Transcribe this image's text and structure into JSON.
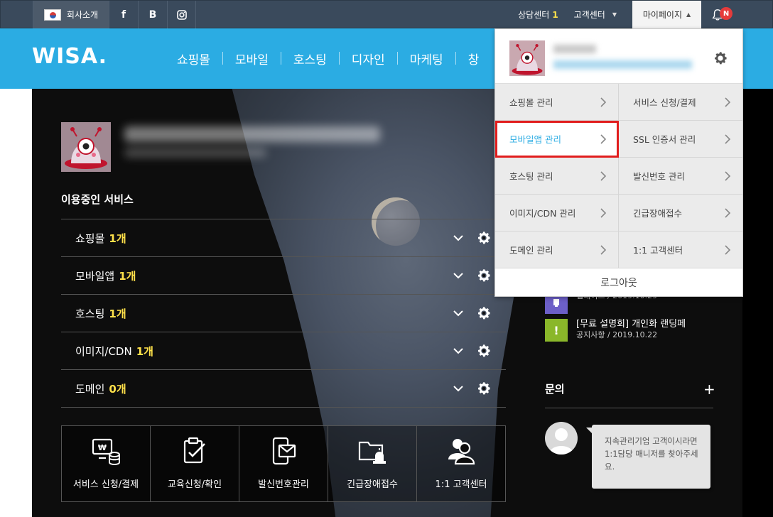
{
  "topbar": {
    "company_label": "회사소개",
    "sns": [
      "f",
      "B"
    ],
    "consult_label": "상담센터",
    "consult_count": "1",
    "support_label": "고객센터",
    "mypage_label": "마이페이지",
    "notification_badge": "N"
  },
  "nav": {
    "logo": "WISA.",
    "menu": [
      "쇼핑몰",
      "모바일",
      "호스팅",
      "디자인",
      "마케팅",
      "창"
    ]
  },
  "services": {
    "title": "이용중인 서비스",
    "rows": [
      {
        "label": "쇼핑몰",
        "count": "1개"
      },
      {
        "label": "모바일앱",
        "count": "1개"
      },
      {
        "label": "호스팅",
        "count": "1개"
      },
      {
        "label": "이미지/CDN",
        "count": "1개"
      },
      {
        "label": "도메인",
        "count": "0개"
      }
    ]
  },
  "quick_menu": [
    {
      "label": "서비스 신청/결제",
      "icon": "billing-icon"
    },
    {
      "label": "교육신청/확인",
      "icon": "clipboard-check-icon"
    },
    {
      "label": "발신번호관리",
      "icon": "phone-mail-icon"
    },
    {
      "label": "긴급장애접수",
      "icon": "emergency-folder-icon"
    },
    {
      "label": "1:1 고객센터",
      "icon": "users-icon"
    }
  ],
  "notices": [
    {
      "title": "",
      "meta": "업데이트 / 2019.10.29",
      "color": "#6c5fc7",
      "icon": "update-icon"
    },
    {
      "title": "[무료 설명회] 개인화 랜딩페",
      "meta": "공지사항 / 2019.10.22",
      "color": "#8ab72a",
      "icon": "exclamation-icon"
    }
  ],
  "inquiry": {
    "title": "문의",
    "message": "지속관리기업 고객이시라면 1:1담당 매니저를 찾아주세요."
  },
  "dropdown": {
    "items": [
      {
        "label": "쇼핑몰 관리"
      },
      {
        "label": "서비스 신청/결제"
      },
      {
        "label": "모바일앱 관리",
        "active": true
      },
      {
        "label": "SSL 인증서 관리"
      },
      {
        "label": "호스팅 관리"
      },
      {
        "label": "발신번호 관리"
      },
      {
        "label": "이미지/CDN 관리"
      },
      {
        "label": "긴급장애접수"
      },
      {
        "label": "도메인 관리"
      },
      {
        "label": "1:1 고객센터"
      }
    ],
    "logout_label": "로그아웃"
  },
  "colors": {
    "nav_blue": "#2bace3",
    "topbar": "#3a4a5c",
    "highlight": "#ffe14a",
    "active_outline": "#e11d1d"
  }
}
